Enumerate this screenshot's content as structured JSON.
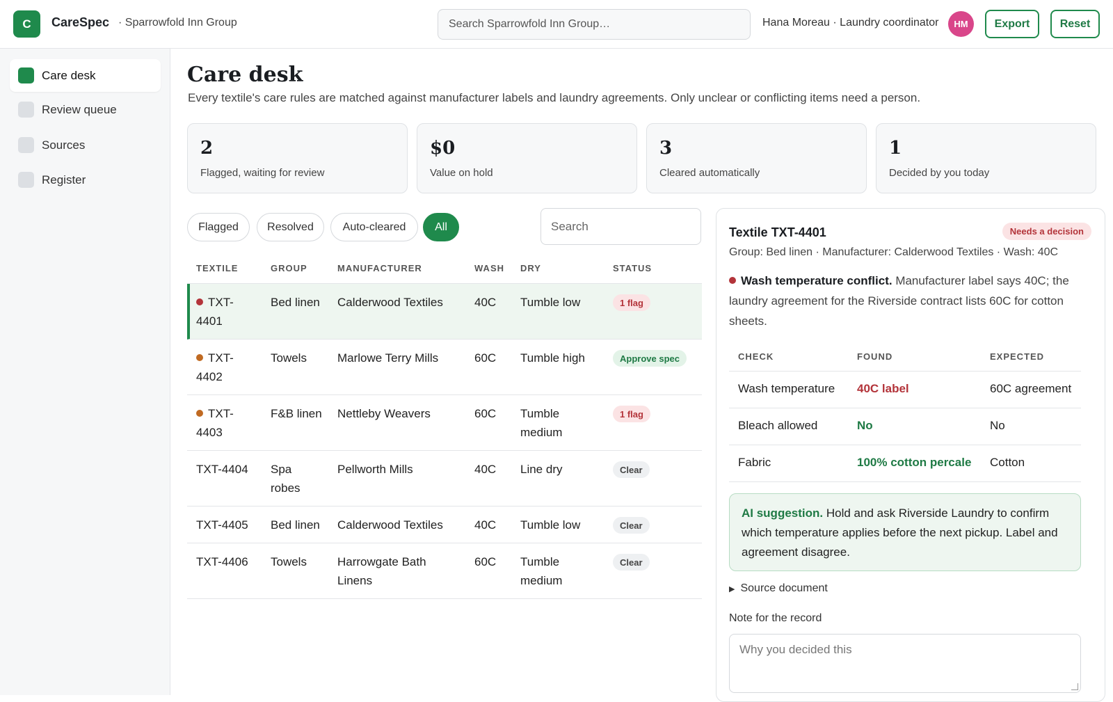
{
  "app": {
    "logo_letter": "C",
    "name": "CareSpec",
    "org": "· Sparrowfold Inn Group"
  },
  "header": {
    "search_placeholder": "Search Sparrowfold Inn Group…",
    "user": "Hana Moreau · Laundry coordinator",
    "avatar_initials": "HM",
    "export_label": "Export",
    "reset_label": "Reset"
  },
  "sidebar": {
    "items": [
      {
        "label": "Care desk",
        "active": true
      },
      {
        "label": "Review queue",
        "active": false
      },
      {
        "label": "Sources",
        "active": false
      },
      {
        "label": "Register",
        "active": false
      }
    ]
  },
  "page": {
    "title": "Care desk",
    "subtitle": "Every textile's care rules are matched against manufacturer labels and laundry agreements. Only unclear or conflicting items need a person."
  },
  "stats": [
    {
      "value": "2",
      "label": "Flagged, waiting for review"
    },
    {
      "value": "$0",
      "label": "Value on hold"
    },
    {
      "value": "3",
      "label": "Cleared automatically"
    },
    {
      "value": "1",
      "label": "Decided by you today"
    }
  ],
  "filters": {
    "pills": [
      "Flagged",
      "Resolved",
      "Auto-cleared",
      "All"
    ],
    "active": "All",
    "search_placeholder": "Search"
  },
  "table": {
    "columns": [
      "TEXTILE",
      "GROUP",
      "MANUFACTURER",
      "WASH",
      "DRY",
      "STATUS"
    ],
    "rows": [
      {
        "textile": "TXT-4401",
        "textile_l1": "TXT-",
        "textile_l2": "4401",
        "group": "Bed linen",
        "manufacturer": "Calderwood Textiles",
        "wash": "40C",
        "dry": "Tumble low",
        "status": "1 flag",
        "status_kind": "flag",
        "dot": "#b3343a"
      },
      {
        "textile": "TXT-4402",
        "textile_l1": "TXT-",
        "textile_l2": "4402",
        "group": "Towels",
        "manufacturer": "Marlowe Terry Mills",
        "wash": "60C",
        "dry": "Tumble high",
        "status": "Approve spec",
        "status_kind": "approve",
        "dot": "#c06a22"
      },
      {
        "textile": "TXT-4403",
        "textile_l1": "TXT-",
        "textile_l2": "4403",
        "group": "F&B linen",
        "manufacturer": "Nettleby Weavers",
        "wash": "60C",
        "dry": "Tumble medium",
        "status": "1 flag",
        "status_kind": "flag",
        "dot": "#c06a22"
      },
      {
        "textile": "TXT-4404",
        "group": "Spa robes",
        "manufacturer": "Pellworth Mills",
        "wash": "40C",
        "dry": "Line dry",
        "status": "Clear",
        "status_kind": "clear"
      },
      {
        "textile": "TXT-4405",
        "group": "Bed linen",
        "manufacturer": "Calderwood Textiles",
        "wash": "40C",
        "dry": "Tumble low",
        "status": "Clear",
        "status_kind": "clear"
      },
      {
        "textile": "TXT-4406",
        "group": "Towels",
        "manufacturer": "Harrowgate Bath Linens",
        "wash": "60C",
        "dry": "Tumble medium",
        "status": "Clear",
        "status_kind": "clear"
      }
    ]
  },
  "detail": {
    "title": "Textile TXT-4401",
    "badge": "Needs a decision",
    "meta": "Group: Bed linen · Manufacturer: Calderwood Textiles · Wash: 40C",
    "conflict_title": "Wash temperature conflict.",
    "conflict_text": " Manufacturer label says 40C; the laundry agreement for the Riverside contract lists 60C for cotton sheets.",
    "check_columns": [
      "CHECK",
      "FOUND",
      "EXPECTED"
    ],
    "checks": [
      {
        "check": "Wash temperature",
        "found": "40C label",
        "expected": "60C agreement",
        "ok": false
      },
      {
        "check": "Bleach allowed",
        "found": "No",
        "expected": "No",
        "ok": true
      },
      {
        "check": "Fabric",
        "found": "100% cotton percale",
        "expected": "Cotton",
        "ok": true
      }
    ],
    "ai_title": "AI suggestion.",
    "ai_text": " Hold and ask Riverside Laundry to confirm which temperature applies before the next pickup. Label and agreement disagree.",
    "source_label": "Source document",
    "note_label": "Note for the record",
    "note_placeholder": "Why you decided this"
  },
  "colors": {
    "accent": "#1f8a4c",
    "flag": "#b3343a",
    "warn": "#c06a22"
  }
}
